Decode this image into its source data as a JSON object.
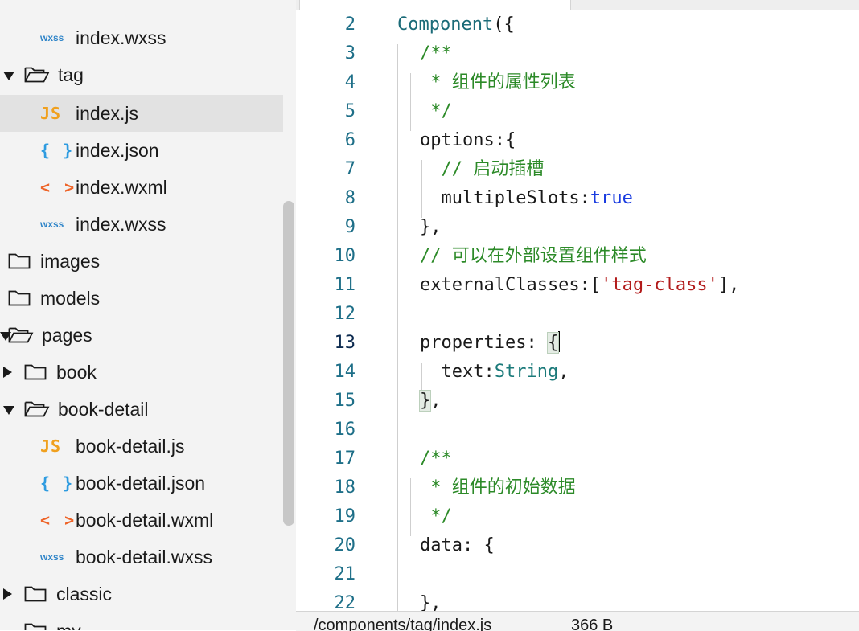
{
  "sidebar": {
    "rows": [
      {
        "kind": "file",
        "icon": "wxss",
        "label": "index.wxss"
      },
      {
        "kind": "folder",
        "open": true,
        "label": "tag"
      },
      {
        "kind": "file",
        "icon": "js",
        "label": "index.js",
        "selected": true
      },
      {
        "kind": "file",
        "icon": "json",
        "label": "index.json"
      },
      {
        "kind": "file",
        "icon": "wxml",
        "label": "index.wxml"
      },
      {
        "kind": "file",
        "icon": "wxss",
        "label": "index.wxss"
      },
      {
        "kind": "folder",
        "label": "images"
      },
      {
        "kind": "folder",
        "label": "models"
      },
      {
        "kind": "folder",
        "open": true,
        "label": "pages"
      },
      {
        "kind": "folder",
        "open": false,
        "label": "book"
      },
      {
        "kind": "folder",
        "open": true,
        "label": "book-detail"
      },
      {
        "kind": "file",
        "icon": "js",
        "label": "book-detail.js"
      },
      {
        "kind": "file",
        "icon": "json",
        "label": "book-detail.json"
      },
      {
        "kind": "file",
        "icon": "wxml",
        "label": "book-detail.wxml"
      },
      {
        "kind": "file",
        "icon": "wxss",
        "label": "book-detail.wxss"
      },
      {
        "kind": "folder",
        "open": false,
        "label": "classic"
      },
      {
        "kind": "folder",
        "label": "my"
      }
    ],
    "icon_text": {
      "js": "JS",
      "json": "{ }",
      "wxml": "< >",
      "wxss": "wxss"
    }
  },
  "editor": {
    "lines": [
      {
        "num": "2",
        "tokens": [
          [
            "fn",
            "Component"
          ],
          [
            "p",
            "({"
          ]
        ]
      },
      {
        "num": "3",
        "tokens": [
          [
            "comment",
            "/**"
          ]
        ]
      },
      {
        "num": "4",
        "tokens": [
          [
            "comment",
            " * 组件的属性列表"
          ]
        ]
      },
      {
        "num": "5",
        "tokens": [
          [
            "comment",
            " */"
          ]
        ]
      },
      {
        "num": "6",
        "tokens": [
          [
            "p",
            "options:{"
          ]
        ]
      },
      {
        "num": "7",
        "tokens": [
          [
            "comment",
            "  // 启动插槽"
          ]
        ]
      },
      {
        "num": "8",
        "tokens": [
          [
            "p",
            "  multipleSlots:"
          ],
          [
            "kw",
            "true"
          ]
        ]
      },
      {
        "num": "9",
        "tokens": [
          [
            "p",
            "},"
          ]
        ]
      },
      {
        "num": "10",
        "tokens": [
          [
            "comment",
            "// 可以在外部设置组件样式"
          ]
        ]
      },
      {
        "num": "11",
        "tokens": [
          [
            "p",
            "externalClasses:["
          ],
          [
            "str",
            "'tag-class'"
          ],
          [
            "p",
            "],"
          ]
        ]
      },
      {
        "num": "12",
        "tokens": []
      },
      {
        "num": "13",
        "current": true,
        "tokens": [
          [
            "p",
            "properties: "
          ],
          [
            "hl",
            "{"
          ],
          [
            "cursor",
            ""
          ]
        ]
      },
      {
        "num": "14",
        "tokens": [
          [
            "p",
            "  text:"
          ],
          [
            "type",
            "String"
          ],
          [
            "p",
            ","
          ]
        ]
      },
      {
        "num": "15",
        "tokens": [
          [
            "hl",
            "}"
          ],
          [
            "p",
            ","
          ]
        ]
      },
      {
        "num": "16",
        "tokens": []
      },
      {
        "num": "17",
        "tokens": [
          [
            "comment",
            "/**"
          ]
        ]
      },
      {
        "num": "18",
        "tokens": [
          [
            "comment",
            " * 组件的初始数据"
          ]
        ]
      },
      {
        "num": "19",
        "tokens": [
          [
            "comment",
            " */"
          ]
        ]
      },
      {
        "num": "20",
        "tokens": [
          [
            "p",
            "data: {"
          ]
        ]
      },
      {
        "num": "21",
        "tokens": []
      },
      {
        "num": "22",
        "tokens": [
          [
            "p",
            "},"
          ]
        ]
      }
    ]
  },
  "status": {
    "path": "/components/tag/index.js",
    "size": "366 B"
  },
  "colors": {
    "js_icon": "#f0a01e",
    "json_icon": "#2d9be0",
    "wxml_icon": "#ee6428",
    "wxss_icon": "#2e84c8",
    "comment": "#2c8a28",
    "keyword": "#1a3ce0",
    "string": "#b21a1a",
    "line_number": "#1e6f88"
  }
}
